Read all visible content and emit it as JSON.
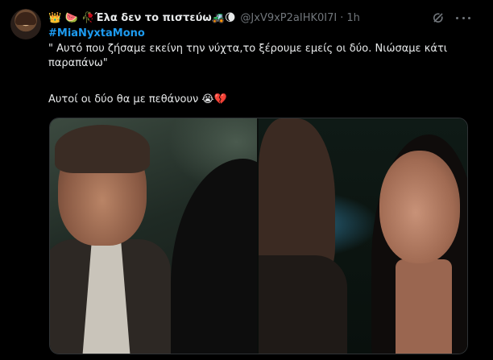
{
  "tweet": {
    "display_name": "👑 🍉 🥀Έλα δεν το πιστεύω🚜🌘",
    "handle": "@JxV9xP2aIHK0I7I",
    "separator": "·",
    "time": "1h",
    "hashtag": "#MiaNyxtaMono",
    "text_line_1": "\" Αυτό που ζήσαμε εκείνη την νύχτα,το ξέρουμε εμείς οι δύο. Νιώσαμε κάτι",
    "text_line_2": "παραπάνω\"",
    "text_line_3": "Αυτοί οι δύο θα με πεθάνουν 😭💔"
  },
  "icons": {
    "grok": "grok-icon",
    "more": "more-options-icon"
  },
  "colors": {
    "background": "#000000",
    "text": "#e7e9ea",
    "secondary_text": "#71767b",
    "link": "#1d9bf0"
  }
}
